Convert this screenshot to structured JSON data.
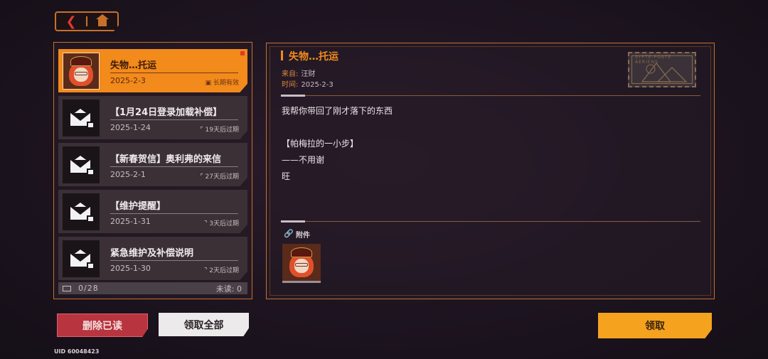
{
  "nav": {
    "back_icon": "back-arrow-icon",
    "home_icon": "home-icon"
  },
  "mail_list": {
    "items": [
      {
        "title": "失物…托运",
        "date": "2025-2-3",
        "expire": "长期有效",
        "active": true,
        "unread": true,
        "icon": "character-avatar"
      },
      {
        "title": "【1月24日登录加载补偿】",
        "date": "2025-1-24",
        "expire": "19天后过期",
        "active": false,
        "icon": "envelope-gift-icon"
      },
      {
        "title": "【新春贺信】奥利弗的来信",
        "date": "2025-2-1",
        "expire": "27天后过期",
        "active": false,
        "icon": "envelope-gift-icon"
      },
      {
        "title": "【维护提醒】",
        "date": "2025-1-31",
        "expire": "3天后过期",
        "active": false,
        "icon": "envelope-gift-icon"
      },
      {
        "title": "紧急维护及补偿说明",
        "date": "2025-1-30",
        "expire": "2天后过期",
        "active": false,
        "icon": "envelope-gift-icon"
      }
    ],
    "count": "0/28",
    "unread_label": "未读:  0"
  },
  "detail": {
    "title": "失物…托运",
    "from_label": "来自:",
    "from_value": "汪财",
    "time_label": "时间:",
    "time_value": "2025-2-3",
    "body": "我帮你带回了刚才落下的东西\n\n【帕梅拉的一小步】\n——不用谢\n旺",
    "stamp_text": "SYPTE-POSTE AERIENS",
    "attachment_label": "附件"
  },
  "buttons": {
    "delete_read": "删除已读",
    "claim_all": "领取全部",
    "claim": "领取"
  },
  "uid": "UID 60048423",
  "colors": {
    "accent": "#f28a1c",
    "border": "#c8702a",
    "danger": "#b8343f",
    "gold": "#f5a31e"
  }
}
